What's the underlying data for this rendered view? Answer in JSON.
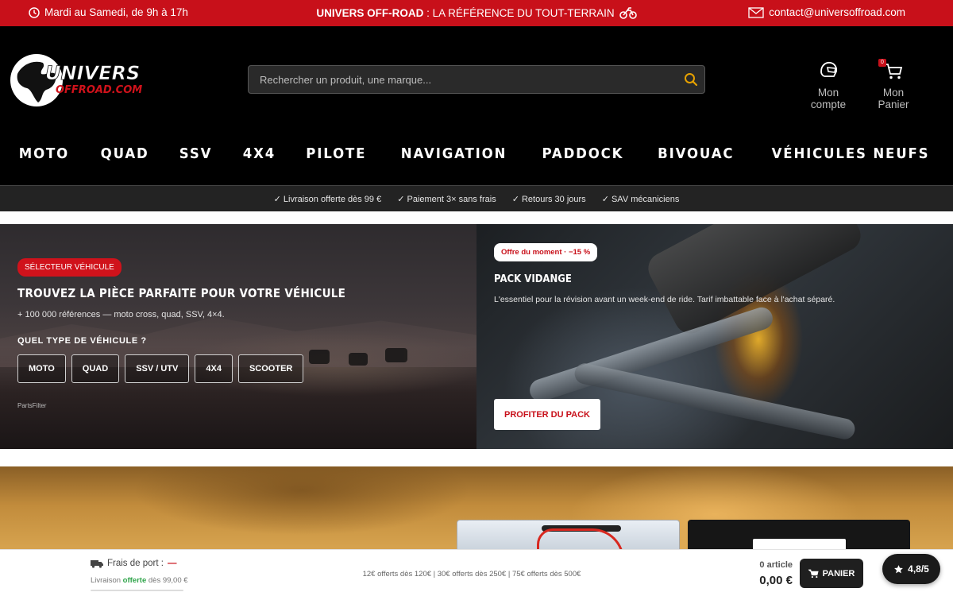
{
  "topbar": {
    "hours": "Mardi au Samedi, de 9h à 17h",
    "brand": "UNIVERS OFF-ROAD",
    "tagline": " : LA RÉFÉRENCE DU TOUT-TERRAIN",
    "email": "contact@universoffroad.com",
    "color": "#c8101a"
  },
  "header": {
    "logo_line1": "UNIVERS",
    "logo_line2": "OFFROAD.COM",
    "search_placeholder": "Rechercher un produit, une marque...",
    "account_label": "Mon compte",
    "cart_label": "Mon Panier",
    "cart_count": "0"
  },
  "nav": {
    "items": [
      "MOTO",
      "QUAD",
      "SSV",
      "4X4",
      "PILOTE",
      "NAVIGATION",
      "PADDOCK",
      "BIVOUAC",
      "VÉHICULES NEUFS"
    ]
  },
  "benefits": [
    "✓ Livraison offerte dès 99 €",
    "✓ Paiement 3× sans frais",
    "✓ Retours 30 jours",
    "✓ SAV mécaniciens"
  ],
  "hero_left": {
    "tag": "SÉLECTEUR VÉHICULE",
    "title": "TROUVEZ LA PIÈCE PARFAITE POUR VOTRE VÉHICULE",
    "subtitle": "+ 100 000 références — moto cross, quad, SSV, 4×4.",
    "question": "QUEL TYPE DE VÉHICULE ?",
    "vehicles": [
      "MOTO",
      "QUAD",
      "SSV / UTV",
      "4X4",
      "SCOOTER"
    ],
    "credit": "PartsFilter"
  },
  "hero_right": {
    "offer": "Offre du moment · −15 %",
    "title": "PACK VIDANGE",
    "description": "L'essentiel pour la révision avant un week-end de ride. Tarif imbattable face à l'achat séparé.",
    "button": "PROFITER DU PACK"
  },
  "sticky": {
    "shipping_label": "Frais de port :",
    "shipping_value": "—",
    "free_prefix": "Livraison ",
    "free_word": "offerte",
    "free_suffix": " dès 99,00 €",
    "tiers": "12€ offerts dès 120€ | 30€ offerts dès 250€ | 75€ offerts dès 500€",
    "article_count": "0 article",
    "total": "0,00 €",
    "cart_button": "PANIER"
  },
  "rating": {
    "value": "4,8/5"
  }
}
